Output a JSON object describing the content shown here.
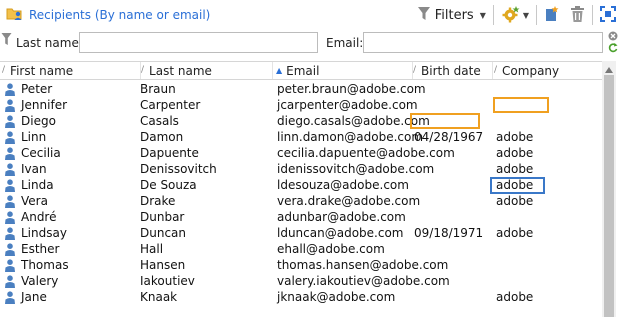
{
  "toolbar": {
    "title": "Recipients (By name or email)",
    "filters_label": "Filters",
    "icons": [
      "folder-person-icon",
      "funnel-icon",
      "chevron-down-icon",
      "gear-star-icon",
      "chevron-down-icon",
      "new-item-icon",
      "trash-icon",
      "fullscreen-icon"
    ]
  },
  "filter": {
    "last_name_label": "Last name:",
    "last_name_value": "",
    "email_label": "Email:",
    "email_value": ""
  },
  "columns": [
    {
      "label": "First name"
    },
    {
      "label": "Last name"
    },
    {
      "label": "Email",
      "sorted": "ascending"
    },
    {
      "label": "Birth date"
    },
    {
      "label": "Company"
    }
  ],
  "rows": [
    {
      "first": "Peter",
      "last": "Braun",
      "email": "peter.braun@adobe.com",
      "birth": "",
      "company": ""
    },
    {
      "first": "Jennifer",
      "last": "Carpenter",
      "email": "jcarpenter@adobe.com",
      "birth": "",
      "company": ""
    },
    {
      "first": "Diego",
      "last": "Casals",
      "email": "diego.casals@adobe.com",
      "birth": "",
      "company": ""
    },
    {
      "first": "Linn",
      "last": "Damon",
      "email": "linn.damon@adobe.com",
      "birth": "04/28/1967",
      "company": "adobe"
    },
    {
      "first": "Cecilia",
      "last": "Dapuente",
      "email": "cecilia.dapuente@adobe.com",
      "birth": "",
      "company": "adobe"
    },
    {
      "first": "Ivan",
      "last": "Denissovitch",
      "email": "idenissovitch@adobe.com",
      "birth": "",
      "company": "adobe"
    },
    {
      "first": "Linda",
      "last": "De Souza",
      "email": "ldesouza@adobe.com",
      "birth": "",
      "company": "adobe"
    },
    {
      "first": "Vera",
      "last": "Drake",
      "email": "vera.drake@adobe.com",
      "birth": "",
      "company": "adobe"
    },
    {
      "first": "André",
      "last": "Dunbar",
      "email": "adunbar@adobe.com",
      "birth": "",
      "company": ""
    },
    {
      "first": "Lindsay",
      "last": "Duncan",
      "email": "lduncan@adobe.com",
      "birth": "09/18/1971",
      "company": "adobe"
    },
    {
      "first": "Esther",
      "last": "Hall",
      "email": "ehall@adobe.com",
      "birth": "",
      "company": ""
    },
    {
      "first": "Thomas",
      "last": "Hansen",
      "email": "thomas.hansen@adobe.com",
      "birth": "",
      "company": ""
    },
    {
      "first": "Valery",
      "last": "Iakoutiev",
      "email": "valery.iakoutiev@adobe.com",
      "birth": "",
      "company": ""
    },
    {
      "first": "Jane",
      "last": "Knaak",
      "email": "jknaak@adobe.com",
      "birth": "",
      "company": "adobe"
    }
  ],
  "colors": {
    "accent_blue": "#2a6fd6",
    "highlight_orange": "#f0a020",
    "highlight_blue": "#3a78c8",
    "person_icon": "#4a7fc0"
  }
}
